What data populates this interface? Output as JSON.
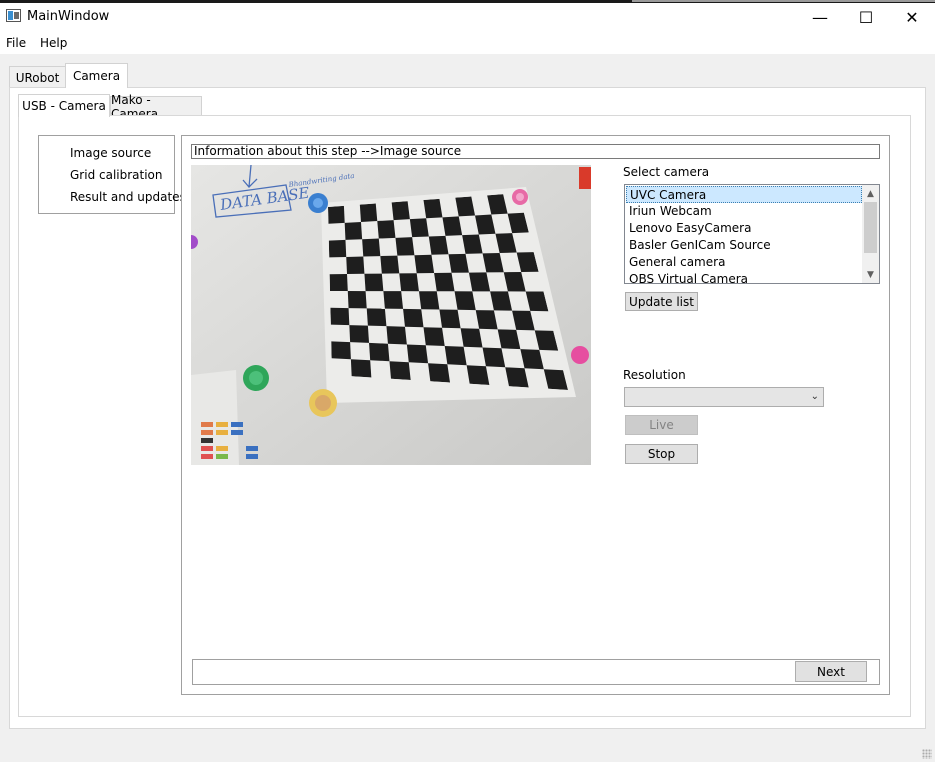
{
  "window": {
    "title": "MainWindow",
    "controls": {
      "minimize": "—",
      "maximize": "☐",
      "close": "✕"
    }
  },
  "menu": {
    "file": "File",
    "help": "Help"
  },
  "tabs": [
    {
      "label": "URobot"
    },
    {
      "label": "Camera"
    }
  ],
  "subtabs": [
    {
      "label": "USB - Camera"
    },
    {
      "label": "Mako - Camera"
    }
  ],
  "steps": [
    {
      "label": "Image source"
    },
    {
      "label": "Grid calibration"
    },
    {
      "label": "Result and updates"
    }
  ],
  "info": {
    "text": "Information about this step -->Image source"
  },
  "camera_view": {
    "whiteboard_text": "DATA BASE",
    "note_text": "Bhandwriting data"
  },
  "select_camera": {
    "label": "Select camera",
    "items": [
      {
        "label": "UVC Camera"
      },
      {
        "label": "Iriun Webcam"
      },
      {
        "label": "Lenovo EasyCamera"
      },
      {
        "label": "Basler GenICam Source"
      },
      {
        "label": "General camera"
      },
      {
        "label": "OBS Virtual Camera"
      }
    ],
    "selected": "UVC Camera"
  },
  "buttons": {
    "update_list": "Update list",
    "live": "Live",
    "stop": "Stop",
    "next": "Next"
  },
  "resolution": {
    "label": "Resolution",
    "value": ""
  },
  "colors": {
    "selection": "#cce8ff",
    "window_bg": "#f0f0f0",
    "pane_bg": "#ffffff"
  }
}
